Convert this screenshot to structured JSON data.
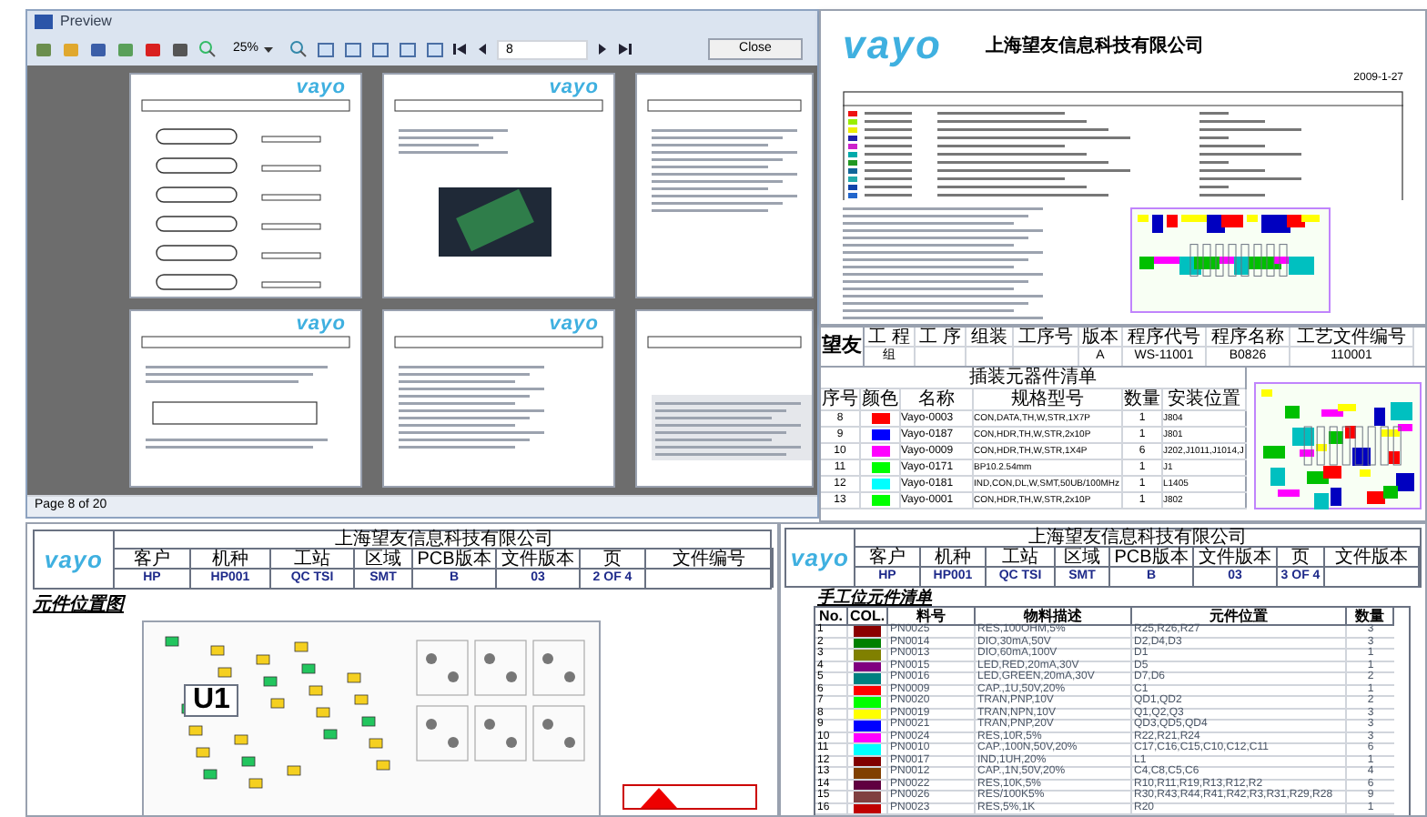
{
  "preview_window": {
    "title": "Preview",
    "toolbar": {
      "zoom": "25%",
      "page": "8",
      "close": "Close"
    },
    "thumbnails": [
      {
        "logo": "vayo",
        "kind": "flowchart"
      },
      {
        "logo": "vayo",
        "kind": "photo"
      },
      {
        "kind": "text"
      },
      {
        "logo": "vayo",
        "kind": "table"
      },
      {
        "logo": "vayo",
        "kind": "text"
      },
      {
        "kind": "board"
      }
    ],
    "status_bar": "Page 8 of 20"
  },
  "doc_top": {
    "logo": "vayo",
    "company": "上海望友信息科技有限公司",
    "date": "2009-1-27"
  },
  "doc_middle": {
    "logo": "望友",
    "header": [
      {
        "label": "工 程",
        "value": "组"
      },
      {
        "label": "工 序"
      },
      {
        "label": "组装"
      },
      {
        "label": "工序号"
      },
      {
        "label": "版本",
        "value": "A"
      },
      {
        "label": "程序代号",
        "value": "WS-11001"
      },
      {
        "label": "程序名称",
        "value": "B0826"
      },
      {
        "label": "工艺文件编号",
        "value": "110001"
      }
    ],
    "table_title": "插装元器件清单",
    "columns": [
      "序号",
      "颜色",
      "名称",
      "规格型号",
      "数量",
      "安装位置"
    ],
    "rows": [
      {
        "no": "8",
        "color": "#ff0000",
        "name": "Vayo-0003",
        "spec": "CON,DATA,TH,W,STR,1X7P",
        "qty": "1",
        "position": "J804"
      },
      {
        "no": "9",
        "color": "#0000ff",
        "name": "Vayo-0187",
        "spec": "CON,HDR,TH,W,STR,2x10P",
        "qty": "1",
        "position": "J801"
      },
      {
        "no": "10",
        "color": "#ff00ff",
        "name": "Vayo-0009",
        "spec": "CON,HDR,TH,W,STR,1X4P",
        "qty": "6",
        "position": "J202,J1011,J1014,J"
      },
      {
        "no": "11",
        "color": "#00ff00",
        "name": "Vayo-0171",
        "spec": "BP10.2.54mm",
        "qty": "1",
        "position": "J1"
      },
      {
        "no": "12",
        "color": "#00ffff",
        "name": "Vayo-0181",
        "spec": "IND,CON,DL,W,SMT,50UB/100MHz",
        "qty": "1",
        "position": "L1405"
      },
      {
        "no": "13",
        "color": "#00ff00",
        "name": "Vayo-0001",
        "spec": "CON,HDR,TH,W,STR,2x10P",
        "qty": "1",
        "position": "J802"
      }
    ]
  },
  "doc_bottom_left": {
    "logo": "vayo",
    "company": "上海望友信息科技有限公司",
    "header": [
      {
        "label": "客户",
        "value": "HP"
      },
      {
        "label": "机种",
        "value": "HP001"
      },
      {
        "label": "工站",
        "value": "QC TSI"
      },
      {
        "label": "区域",
        "value": "SMT"
      },
      {
        "label": "PCB版本",
        "value": "B"
      },
      {
        "label": "文件版本",
        "value": "03"
      },
      {
        "label": "页",
        "value": "2 OF 4"
      },
      {
        "label": "文件编号"
      }
    ],
    "section": "元件位置图",
    "board_label": "U1"
  },
  "doc_bottom_right": {
    "logo": "vayo",
    "company": "上海望友信息科技有限公司",
    "header": [
      {
        "label": "客户",
        "value": "HP"
      },
      {
        "label": "机种",
        "value": "HP001"
      },
      {
        "label": "工站",
        "value": "QC TSI"
      },
      {
        "label": "区域",
        "value": "SMT"
      },
      {
        "label": "PCB版本",
        "value": "B"
      },
      {
        "label": "文件版本",
        "value": "03"
      },
      {
        "label": "页",
        "value": "3 OF 4"
      },
      {
        "label": "文件版本"
      }
    ],
    "section": "手工位元件清单",
    "columns": [
      "No.",
      "COL.",
      "料号",
      "物料描述",
      "元件位置",
      "数量"
    ],
    "rows": [
      {
        "no": "1",
        "color": "#8b0000",
        "part": "PN0025",
        "desc": "RES,100OHM,5%",
        "position": "R25,R26,R27",
        "qty": "3"
      },
      {
        "no": "2",
        "color": "#008000",
        "part": "PN0014",
        "desc": "DIO,30mA,50V",
        "position": "D2,D4,D3",
        "qty": "3"
      },
      {
        "no": "3",
        "color": "#808000",
        "part": "PN0013",
        "desc": "DIO,60mA,100V",
        "position": "D1",
        "qty": "1"
      },
      {
        "no": "4",
        "color": "#800080",
        "part": "PN0015",
        "desc": "LED,RED,20mA,30V",
        "position": "D5",
        "qty": "1"
      },
      {
        "no": "5",
        "color": "#008080",
        "part": "PN0016",
        "desc": "LED,GREEN,20mA,30V",
        "position": "D7,D6",
        "qty": "2"
      },
      {
        "no": "6",
        "color": "#ff0000",
        "part": "PN0009",
        "desc": "CAP.,1U,50V,20%",
        "position": "C1",
        "qty": "1"
      },
      {
        "no": "7",
        "color": "#00ff00",
        "part": "PN0020",
        "desc": "TRAN,PNP,10V",
        "position": "QD1,QD2",
        "qty": "2"
      },
      {
        "no": "8",
        "color": "#ffff00",
        "part": "PN0019",
        "desc": "TRAN,NPN,10V",
        "position": "Q1,Q2,Q3",
        "qty": "3"
      },
      {
        "no": "9",
        "color": "#0000ff",
        "part": "PN0021",
        "desc": "TRAN,PNP,20V",
        "position": "QD3,QD5,QD4",
        "qty": "3"
      },
      {
        "no": "10",
        "color": "#ff00ff",
        "part": "PN0024",
        "desc": "RES,10R,5%",
        "position": "R22,R21,R24",
        "qty": "3"
      },
      {
        "no": "11",
        "color": "#00ffff",
        "part": "PN0010",
        "desc": "CAP.,100N,50V,20%",
        "position": "C17,C16,C15,C10,C12,C11",
        "qty": "6"
      },
      {
        "no": "12",
        "color": "#800000",
        "part": "PN0017",
        "desc": "IND,1UH,20%",
        "position": "L1",
        "qty": "1"
      },
      {
        "no": "13",
        "color": "#804000",
        "part": "PN0012",
        "desc": "CAP.,1N,50V,20%",
        "position": "C4,C8,C5,C6",
        "qty": "4"
      },
      {
        "no": "14",
        "color": "#600040",
        "part": "PN0022",
        "desc": "RES,10K,5%",
        "position": "R10,R11,R19,R13,R12,R2",
        "qty": "6"
      },
      {
        "no": "15",
        "color": "#804040",
        "part": "PN0026",
        "desc": "RES/100K5%",
        "position": "R30,R43,R44,R41,R42,R3,R31,R29,R28",
        "qty": "9"
      },
      {
        "no": "16",
        "color": "#c00000",
        "part": "PN0023",
        "desc": "RES,5%,1K",
        "position": "R20",
        "qty": "1"
      }
    ]
  }
}
